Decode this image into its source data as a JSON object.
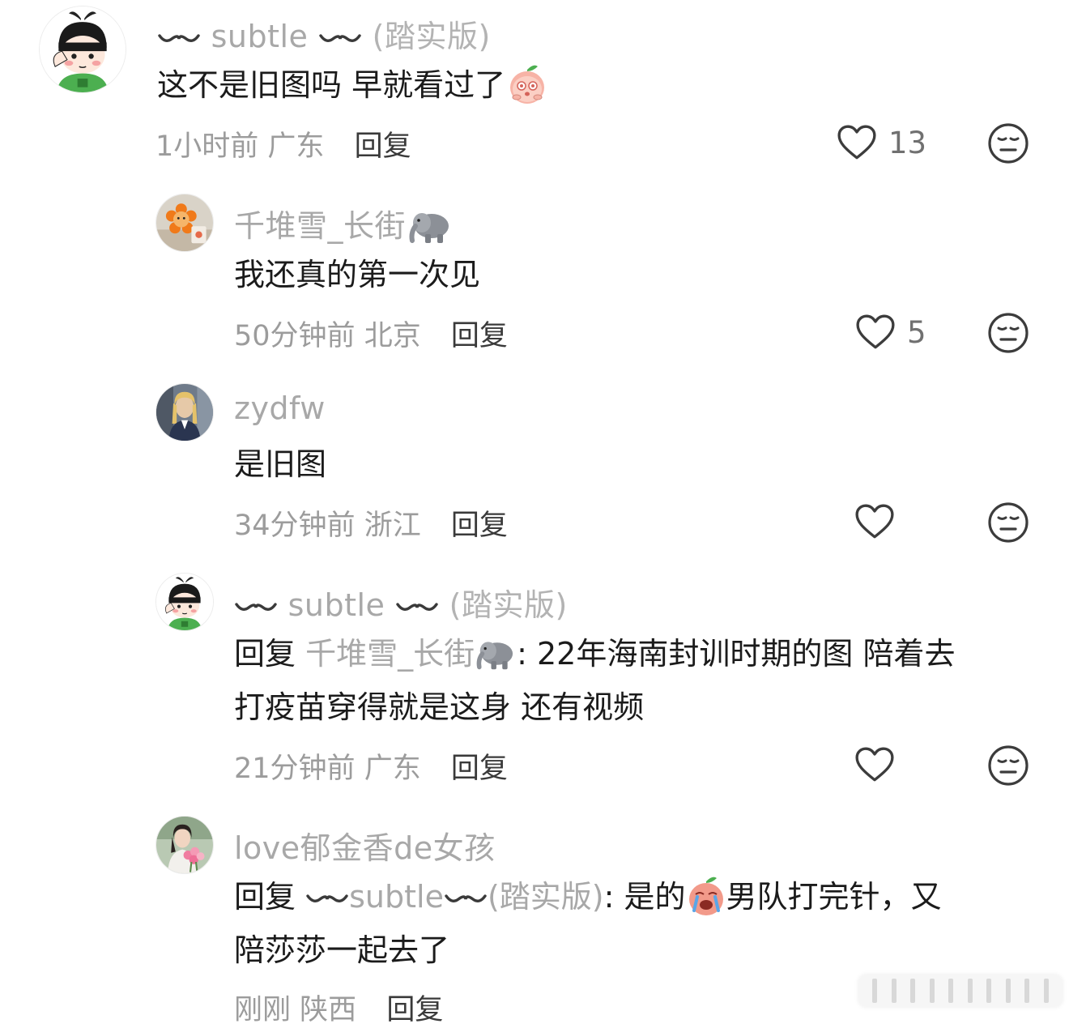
{
  "comments": [
    {
      "user": "subtle",
      "edition": "(踏实版)",
      "text": "这不是旧图吗 早就看过了",
      "time": "1小时前",
      "location": "广东",
      "reply_label": "回复",
      "likes": "13",
      "avatar_icon": "cartoon-boy-avatar"
    },
    {
      "user": "千堆雪_长街",
      "text": "我还真的第一次见",
      "time": "50分钟前",
      "location": "北京",
      "reply_label": "回复",
      "likes": "5",
      "avatar_icon": "orange-flower-toy-avatar"
    },
    {
      "user": "zydfw",
      "text": "是旧图",
      "time": "34分钟前",
      "location": "浙江",
      "reply_label": "回复",
      "likes": "",
      "avatar_icon": "person-photo-avatar"
    },
    {
      "user": "subtle",
      "edition": "(踏实版)",
      "reply_prefix": "回复",
      "mention": "千堆雪_长街",
      "text_line1": ": 22年海南封训时期的图 陪着去",
      "text_line2": "打疫苗穿得就是这身 还有视频",
      "time": "21分钟前",
      "location": "广东",
      "reply_label": "回复",
      "likes": "",
      "avatar_icon": "cartoon-boy-avatar"
    },
    {
      "user": "love郁金香de女孩",
      "reply_prefix": "回复",
      "mention_user": "subtle",
      "mention_edition": "(踏实版)",
      "text_part1": ": 是的",
      "text_part2": "男队打完针，又",
      "text_line2": "陪莎莎一起去了",
      "time": "刚刚",
      "location": "陕西",
      "reply_label": "回复",
      "likes": "",
      "avatar_icon": "woman-with-flowers-avatar"
    }
  ],
  "icons": {
    "like": "heart-outline-icon",
    "dislike": "meh-face-icon",
    "elephant": "elephant-emoji",
    "blush_peach": "blushing-peach-emoji",
    "crying_peach": "crying-peach-emoji"
  }
}
